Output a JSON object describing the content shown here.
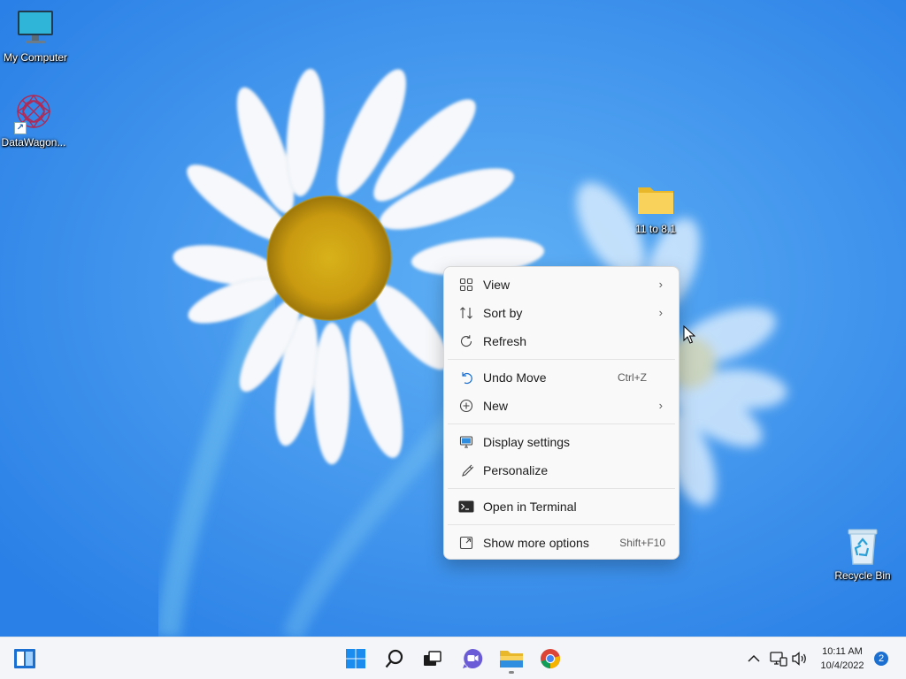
{
  "desktop": {
    "icons": [
      {
        "label": "My Computer"
      },
      {
        "label": "DataWagon..."
      },
      {
        "label": "11 to 8.1"
      },
      {
        "label": "Recycle Bin"
      }
    ]
  },
  "context_menu": {
    "items": [
      {
        "label": "View",
        "icon": "view-grid-icon",
        "submenu": true
      },
      {
        "label": "Sort by",
        "icon": "sort-icon",
        "submenu": true
      },
      {
        "label": "Refresh",
        "icon": "refresh-icon"
      },
      {
        "label": "Undo Move",
        "icon": "undo-icon",
        "shortcut": "Ctrl+Z"
      },
      {
        "label": "New",
        "icon": "new-plus-icon",
        "submenu": true
      },
      {
        "label": "Display settings",
        "icon": "display-icon"
      },
      {
        "label": "Personalize",
        "icon": "brush-icon"
      },
      {
        "label": "Open in Terminal",
        "icon": "terminal-icon"
      },
      {
        "label": "Show more options",
        "icon": "expand-icon",
        "shortcut": "Shift+F10"
      }
    ]
  },
  "taskbar": {
    "time": "10:11 AM",
    "date": "10/4/2022",
    "notification_count": "2"
  },
  "colors": {
    "accent": "#1a6fd1",
    "menu_bg": "#f9f9f9",
    "taskbar_bg": "#f3f5f9"
  }
}
